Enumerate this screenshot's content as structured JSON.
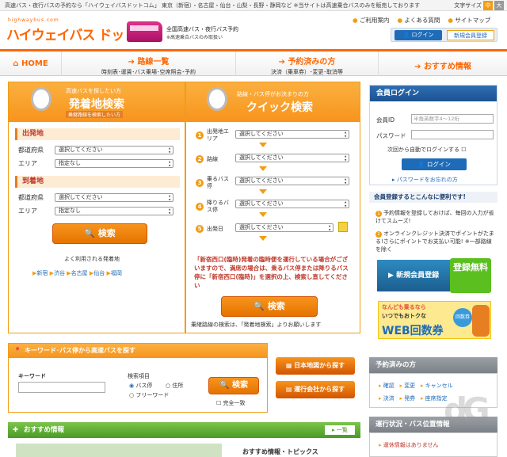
{
  "topbar": {
    "text": "高速バス・夜行バスの予約なら「ハイウェイバスドットコム」 東京（新宿）・名古屋・仙台・山梨・長野・静岡など ※当サイトは高速乗合バスのみを販売しております",
    "font_size_label": "文字サイズ",
    "font_mid": "中",
    "font_large": "大"
  },
  "header": {
    "logo_small": "highwaybus.com",
    "logo": "ハイウェイバス ドットコム",
    "tagline1": "全国高速バス・夜行バス予約",
    "tagline2": "※高速乗合バスのみ取扱い",
    "links": [
      "ご利用案内",
      "よくある質問",
      "サイトマップ"
    ],
    "login_button": "ログイン",
    "register_button": "新規会員登録"
  },
  "nav": {
    "home": "HOME",
    "items": [
      {
        "title": "路線一覧",
        "sub": "時刻表･運賃･バス乗場･空席照会･予約"
      },
      {
        "title": "予約済みの方",
        "sub": "決済（乗車券）･変更･取消等"
      },
      {
        "title": "おすすめ情報",
        "sub": ""
      }
    ]
  },
  "depart_search": {
    "small": "高速バスを探したい方",
    "title": "発着地検索",
    "sub": "乗継路線を検索したい方",
    "depart_label": "出発地",
    "arrive_label": "到着地",
    "pref_label": "都道府県",
    "area_label": "エリア",
    "pref_placeholder": "選択してください",
    "area_placeholder": "指定なし",
    "search_button": "検索",
    "popular_title": "よく利用される発着地",
    "popular": [
      "新宿",
      "渋谷",
      "名古屋",
      "仙台",
      "福岡"
    ]
  },
  "quick_search": {
    "small": "路線・バス停がお決まりの方",
    "title": "クイック検索",
    "steps": [
      {
        "num": "1",
        "label": "出発地エリア",
        "value": "選択してください"
      },
      {
        "num": "2",
        "label": "路線",
        "value": "選択してください"
      },
      {
        "num": "3",
        "label": "乗るバス停",
        "value": "選択してください"
      },
      {
        "num": "4",
        "label": "降りるバス停",
        "value": "選択してください"
      },
      {
        "num": "5",
        "label": "出発日",
        "value": "選択してください"
      }
    ],
    "notice": "「新宿西口(臨時)発着の臨時便を運行している場合がございますので、満席の場合は、乗るバス停または降りるバス停に「新宿西口(臨時)」を選択の上、検索し直してください",
    "search_button": "検索",
    "footer": "乗継路線の検索は、「発着地検索」よりお願いします"
  },
  "keyword": {
    "title": "キーワード･バス停から高速バスを探す",
    "keyword_label": "キーワード",
    "item_label": "検索項目",
    "options": [
      "バス停",
      "住所",
      "フリーワード"
    ],
    "search_button": "検索",
    "exact": "完全一致"
  },
  "side_buttons": [
    "日本地図から探す",
    "運行会社から探す"
  ],
  "recommend": {
    "title": "おすすめ情報",
    "more": "一覧",
    "sub": "おすすめ情報・トピックス"
  },
  "member": {
    "title": "会員ログイン",
    "id_label": "会員ID",
    "id_placeholder": "半角英数字4～12桁",
    "pw_label": "パスワード",
    "auto_login": "次回から自動でログインする",
    "login_button": "ログイン",
    "forgot": "パスワードをお忘れの方"
  },
  "benefits": {
    "title": "会員登録するとこんなに便利です!",
    "items": [
      "予約情報を登録しておけば、毎回の入力が省けてスムーズ!",
      "オンラインクレジット決済でポイントがたまる!さらにポイントでお支払い可能! ※一部路線を除く"
    ],
    "register": "新規会員登録",
    "badge": "登録無料"
  },
  "coupon": {
    "line1": "なんども乗るなら",
    "line2": "いつでもおトクな",
    "title": "WEB回数券",
    "badge": "回数券"
  },
  "reserved": {
    "title": "予約済みの方",
    "links": [
      "確認",
      "変更",
      "キャンセル",
      "決済",
      "発券",
      "座席指定"
    ]
  },
  "status": {
    "title": "運行状況・バス位置情報",
    "link": "運休情報はありません"
  },
  "colors": {
    "orange": "#f7941d",
    "blue": "#1e6bb8",
    "green": "#5bbf20"
  }
}
